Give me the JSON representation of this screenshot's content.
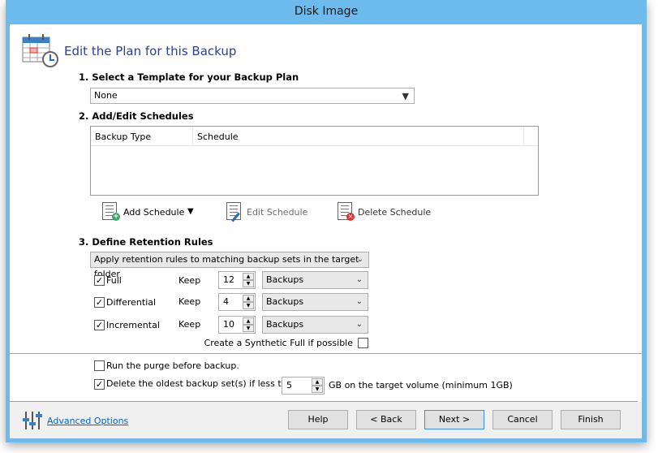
{
  "window": {
    "title": "Disk Image"
  },
  "header": {
    "title": "Edit the Plan for this Backup",
    "title_color": "#2a3e9c"
  },
  "section1": {
    "label": "1. Select a Template for your Backup Plan",
    "template_value": "None"
  },
  "section2": {
    "label": "2. Add/Edit Schedules",
    "columns": [
      "Backup Type",
      "Schedule"
    ],
    "rows": [],
    "toolbar": {
      "add": "Add Schedule",
      "edit": "Edit Schedule",
      "delete": "Delete Schedule"
    }
  },
  "section3": {
    "label": "3. Define Retention Rules",
    "mode": "Apply retention rules to matching backup sets in the target folder",
    "rules": [
      {
        "label": "Full",
        "checked": true,
        "keep_label": "Keep",
        "count": "12",
        "unit": "Backups"
      },
      {
        "label": "Differential",
        "checked": true,
        "keep_label": "Keep",
        "count": "4",
        "unit": "Backups"
      },
      {
        "label": "Incremental",
        "checked": true,
        "keep_label": "Keep",
        "count": "10",
        "unit": "Backups"
      }
    ],
    "synthetic_label": "Create a Synthetic Full if possible",
    "synthetic_checked": false
  },
  "options": {
    "purge_label": "Run the purge before backup.",
    "purge_checked": false,
    "delete_label": "Delete the oldest backup set(s) if less than",
    "delete_checked": true,
    "delete_value": "5",
    "delete_suffix": "GB on the target volume (minimum 1GB)"
  },
  "footer": {
    "advanced": "Advanced Options",
    "help": "Help",
    "back": "< Back",
    "next": "Next >",
    "cancel": "Cancel",
    "finish": "Finish"
  },
  "colors": {
    "frame": "#6cbbec",
    "link": "#0066cc"
  }
}
